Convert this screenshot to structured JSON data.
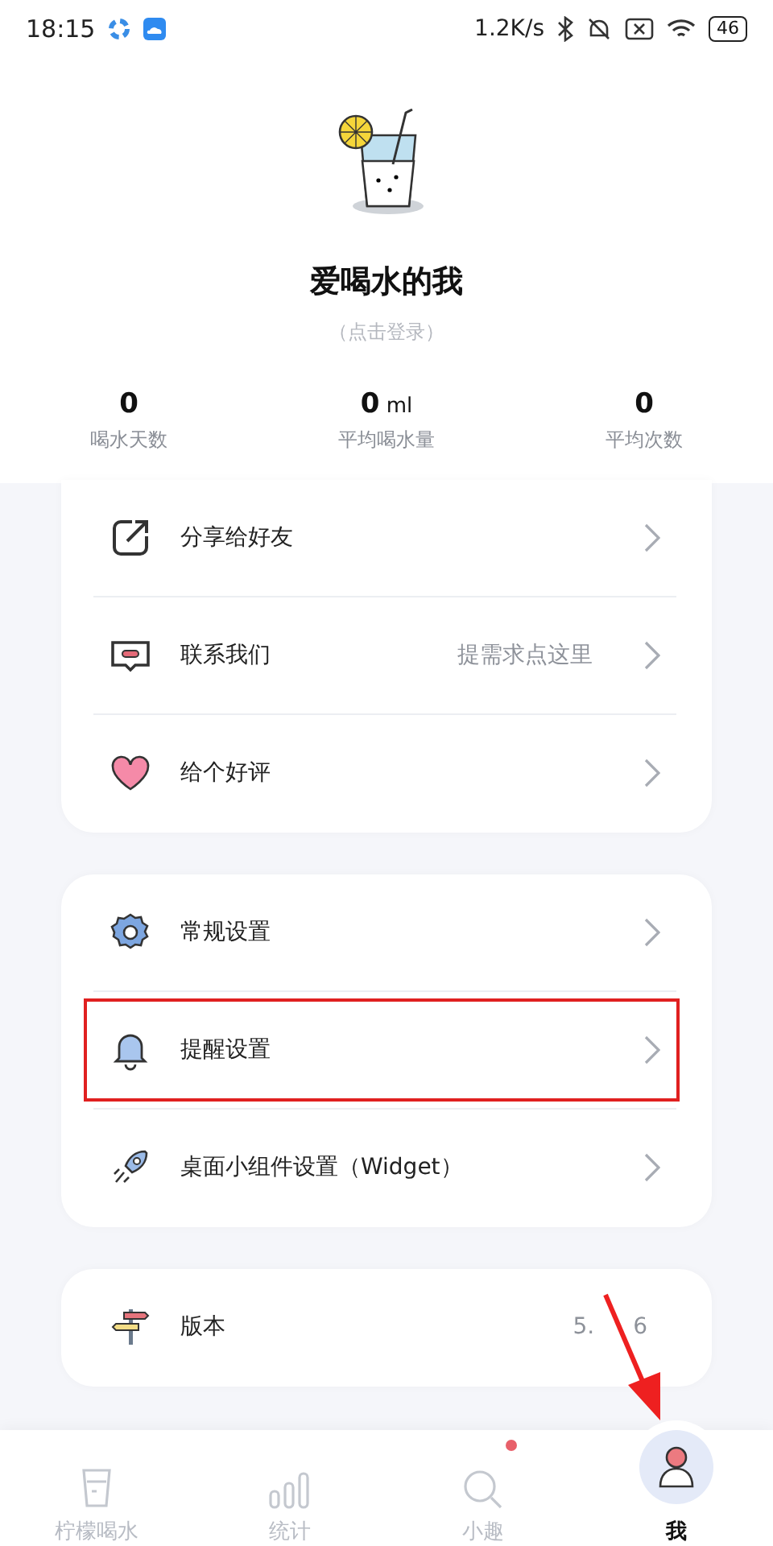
{
  "status_bar": {
    "time": "18:15",
    "speed": "1.2K/s",
    "battery": "46"
  },
  "profile": {
    "name": "爱喝水的我",
    "login_hint": "（点击登录）"
  },
  "stats": [
    {
      "value": "0",
      "label": "喝水天数"
    },
    {
      "value": "0",
      "unit": "ml",
      "label": "平均喝水量"
    },
    {
      "value": "0",
      "label": "平均次数"
    }
  ],
  "groups": [
    {
      "items": [
        {
          "kind": "share",
          "label": "分享给好友",
          "chevron": true,
          "highlighted": false
        },
        {
          "kind": "contact",
          "label": "联系我们",
          "value": "提需求点这里",
          "chevron": true,
          "highlighted": false
        },
        {
          "kind": "rate",
          "label": "给个好评",
          "chevron": true,
          "highlighted": false
        }
      ]
    },
    {
      "items": [
        {
          "kind": "settings",
          "label": "常规设置",
          "chevron": true,
          "highlighted": false
        },
        {
          "kind": "reminder",
          "label": "提醒设置",
          "chevron": true,
          "highlighted": true
        },
        {
          "kind": "widget",
          "label": "桌面小组件设置（Widget）",
          "chevron": true,
          "highlighted": false
        }
      ]
    },
    {
      "items": [
        {
          "kind": "version",
          "label": "版本",
          "value": "5.",
          "value_tail": "6",
          "chevron": false,
          "highlighted": false
        }
      ]
    }
  ],
  "tabs": [
    {
      "kind": "cup",
      "label": "柠檬喝水",
      "selected": false,
      "badge": false
    },
    {
      "kind": "stats",
      "label": "统计",
      "selected": false,
      "badge": false
    },
    {
      "kind": "search",
      "label": "小趣",
      "selected": false,
      "badge": true
    },
    {
      "kind": "me",
      "label": "我",
      "selected": true,
      "badge": false
    }
  ],
  "annotation": {
    "arrow": true
  }
}
